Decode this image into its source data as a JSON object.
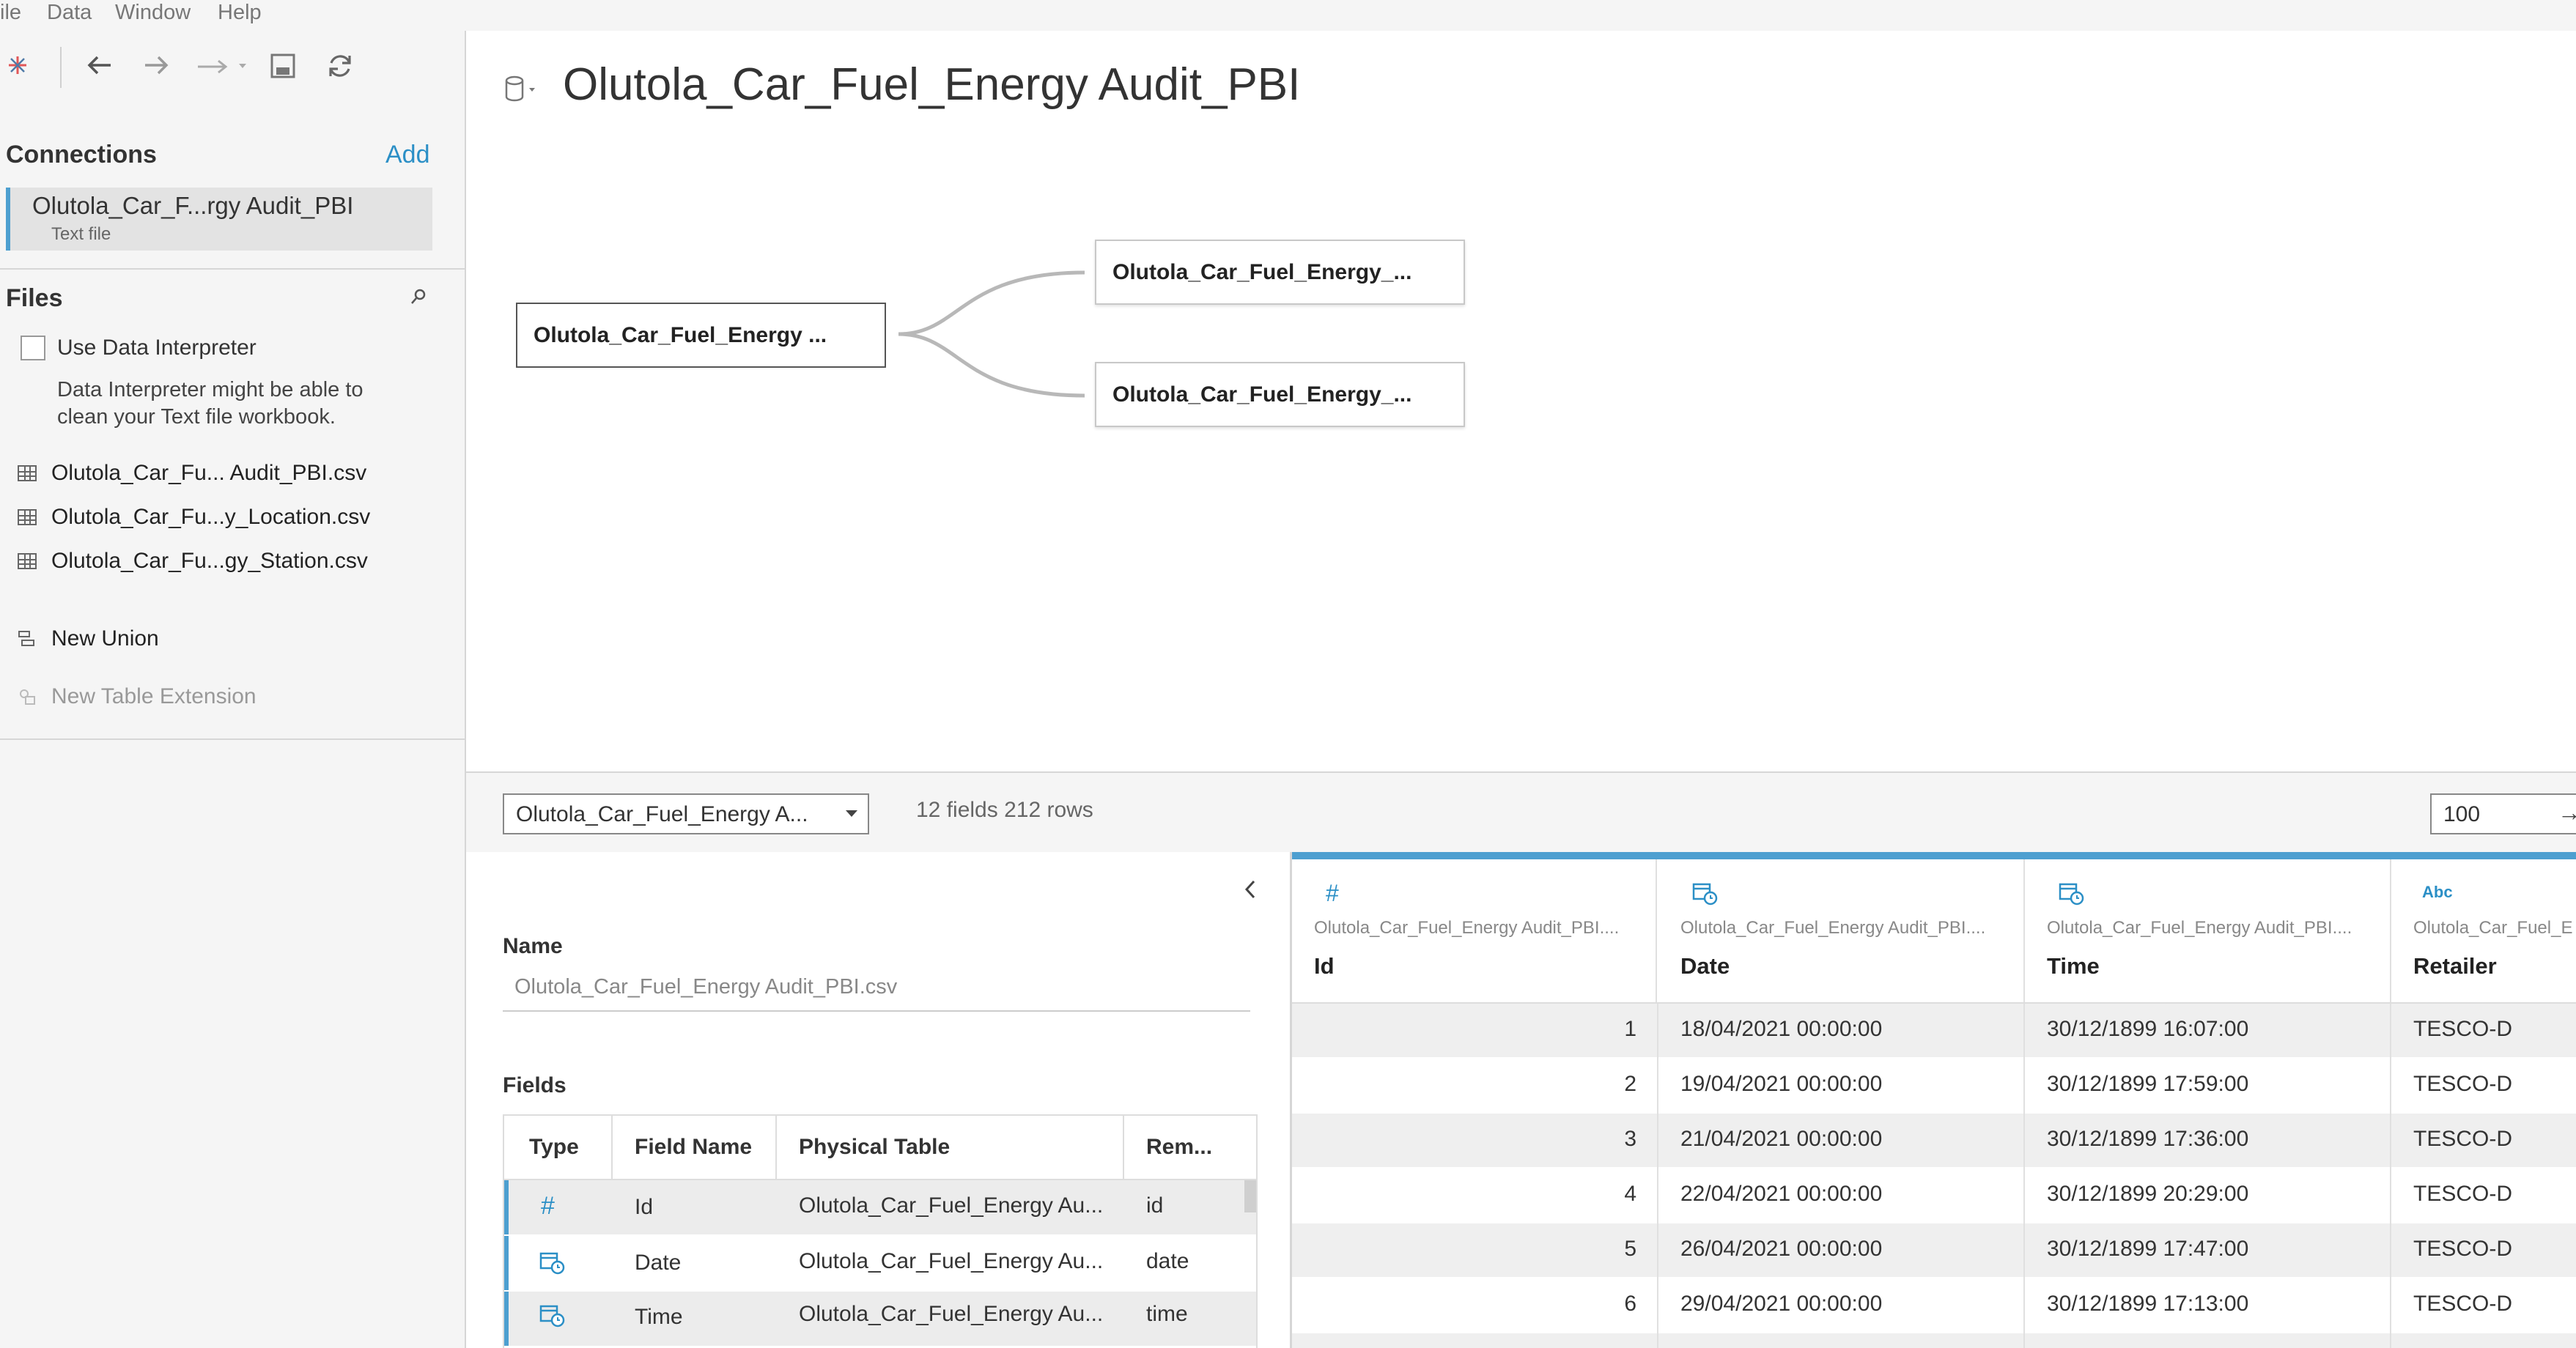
{
  "menu": [
    "ile",
    "Data",
    "Window",
    "Help"
  ],
  "connections": {
    "title": "Connections",
    "add_label": "Add",
    "item_name": "Olutola_Car_F...rgy Audit_PBI",
    "item_type": "Text file"
  },
  "files": {
    "title": "Files",
    "interpreter_label": "Use Data Interpreter",
    "interpreter_note_1": "Data Interpreter might be able to",
    "interpreter_note_2": "clean your Text file workbook.",
    "items": [
      "Olutola_Car_Fu... Audit_PBI.csv",
      "Olutola_Car_Fu...y_Location.csv",
      "Olutola_Car_Fu...gy_Station.csv"
    ],
    "new_union": "New Union",
    "new_table_extension": "New Table Extension"
  },
  "datasource_title": "Olutola_Car_Fuel_Energy Audit_PBI",
  "canvas": {
    "main_table": "Olutola_Car_Fuel_Energy ...",
    "related_1": "Olutola_Car_Fuel_Energy_...",
    "related_2": "Olutola_Car_Fuel_Energy_..."
  },
  "bottom": {
    "table_select": "Olutola_Car_Fuel_Energy A...",
    "stats": "12 fields 212 rows",
    "rows_value": "100"
  },
  "metadata": {
    "name_label": "Name",
    "name_value": "Olutola_Car_Fuel_Energy Audit_PBI.csv",
    "fields_label": "Fields",
    "columns": [
      "Type",
      "Field Name",
      "Physical Table",
      "Rem..."
    ],
    "rows": [
      {
        "type_icon": "number-icon",
        "field": "Id",
        "table": "Olutola_Car_Fuel_Energy Au...",
        "remote": "id"
      },
      {
        "type_icon": "datetime-icon",
        "field": "Date",
        "table": "Olutola_Car_Fuel_Energy Au...",
        "remote": "date"
      },
      {
        "type_icon": "datetime-icon",
        "field": "Time",
        "table": "Olutola_Car_Fuel_Energy Au...",
        "remote": "time"
      }
    ]
  },
  "grid": {
    "columns": [
      {
        "type_icon": "number-icon",
        "type_glyph": "#",
        "source": "Olutola_Car_Fuel_Energy Audit_PBI....",
        "name": "Id"
      },
      {
        "type_icon": "datetime-icon",
        "type_glyph": "",
        "source": "Olutola_Car_Fuel_Energy Audit_PBI....",
        "name": "Date"
      },
      {
        "type_icon": "datetime-icon",
        "type_glyph": "",
        "source": "Olutola_Car_Fuel_Energy Audit_PBI....",
        "name": "Time"
      },
      {
        "type_icon": "string-icon",
        "type_glyph": "Abc",
        "source": "Olutola_Car_Fuel_E",
        "name": "Retailer"
      }
    ],
    "rows": [
      {
        "id": "1",
        "date": "18/04/2021 00:00:00",
        "time": "30/12/1899 16:07:00",
        "retailer": "TESCO-D"
      },
      {
        "id": "2",
        "date": "19/04/2021 00:00:00",
        "time": "30/12/1899 17:59:00",
        "retailer": "TESCO-D"
      },
      {
        "id": "3",
        "date": "21/04/2021 00:00:00",
        "time": "30/12/1899 17:36:00",
        "retailer": "TESCO-D"
      },
      {
        "id": "4",
        "date": "22/04/2021 00:00:00",
        "time": "30/12/1899 20:29:00",
        "retailer": "TESCO-D"
      },
      {
        "id": "5",
        "date": "26/04/2021 00:00:00",
        "time": "30/12/1899 17:47:00",
        "retailer": "TESCO-D"
      },
      {
        "id": "6",
        "date": "29/04/2021 00:00:00",
        "time": "30/12/1899 17:13:00",
        "retailer": "TESCO-D"
      }
    ]
  },
  "colors": {
    "accent": "#2b8fc6",
    "panel_bg": "#f5f5f5",
    "selected_bg": "#e3e3e3"
  }
}
